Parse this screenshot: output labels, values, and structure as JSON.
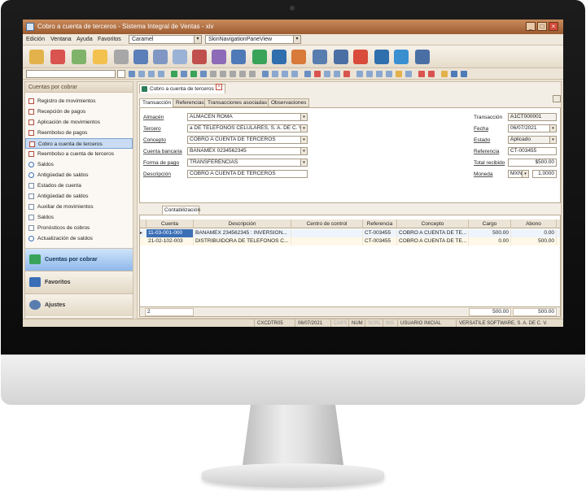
{
  "window": {
    "title": "Cobro a cuenta de terceros - Sistema Integral de Ventas - xiv",
    "minimize": "_",
    "maximize": "□",
    "close": "×"
  },
  "menu": {
    "items": [
      "Edición",
      "Ventana",
      "Ayuda",
      "Favoritos"
    ],
    "skin_combo": "Caramel",
    "nav_combo": "SkinNavigationPaneView"
  },
  "nav": {
    "header": "Cuentas por cobrar",
    "items": [
      {
        "label": "Registro de movimientos",
        "icon": "document-edit-icon"
      },
      {
        "label": "Recepción de pagos",
        "icon": "document-edit-icon"
      },
      {
        "label": "Aplicación de movimientos",
        "icon": "document-edit-icon"
      },
      {
        "label": "Reembolso de pagos",
        "icon": "document-edit-icon"
      },
      {
        "label": "Cobro a cuenta de terceros",
        "icon": "document-edit-icon"
      },
      {
        "label": "Reembolso a cuenta de terceros",
        "icon": "document-edit-icon"
      },
      {
        "label": "Saldos",
        "icon": "search-icon"
      },
      {
        "label": "Antigüedad de saldos",
        "icon": "search-icon"
      },
      {
        "label": "Estados de cuenta",
        "icon": "report-icon"
      },
      {
        "label": "Antigüedad de saldos",
        "icon": "report-icon"
      },
      {
        "label": "Auxiliar de movimientos",
        "icon": "report-icon"
      },
      {
        "label": "Saldos",
        "icon": "report-icon"
      },
      {
        "label": "Pronósticos de cobros",
        "icon": "report-icon"
      },
      {
        "label": "Actualización de saldos",
        "icon": "gear-icon"
      }
    ],
    "groups": [
      {
        "label": "Cuentas por cobrar"
      },
      {
        "label": "Favoritos"
      },
      {
        "label": "Ajustes"
      }
    ]
  },
  "document": {
    "tab_label": "Cobro a cuenta de terceros",
    "subtabs": [
      "Transacción",
      "Referencias",
      "Transacciones asociadas",
      "Observaciones"
    ],
    "fields_left": [
      {
        "label": "Almacén",
        "value": "ALMACEN ROMA"
      },
      {
        "label": "Tercero",
        "value": "a DE TELEFONOS CELULARES, S. A. DE C. V."
      },
      {
        "label": "Concepto",
        "value": "COBRO A CUENTA DE TERCEROS"
      },
      {
        "label": "Cuenta bancaria",
        "value": "BANAMEX 0234562345"
      },
      {
        "label": "Forma de pago",
        "value": "TRANSFERENCIAS"
      },
      {
        "label": "Descripción",
        "value": "COBRO A CUENTA DE TERCEROS"
      }
    ],
    "fields_right": [
      {
        "label": "Transacción",
        "value": "A1CT000001"
      },
      {
        "label": "Fecha",
        "value": "06/07/2021"
      },
      {
        "label": "Estado",
        "value": "Aplicado"
      },
      {
        "label": "Referencia",
        "value": "CT-003455"
      },
      {
        "label": "Total recibido",
        "value": "$500.00"
      },
      {
        "label": "Moneda",
        "value": "MXN",
        "rate": "1.0000"
      }
    ]
  },
  "grid": {
    "tab_label": "Contabilización",
    "columns": [
      "Cuenta",
      "Descripción",
      "Centro de control",
      "Referencia",
      "Concepto",
      "Cargo",
      "Abono"
    ],
    "rows": [
      [
        "11-03-001-000",
        "BANAMEX 234562345 : INVERSION...",
        "",
        "CT-003455",
        "COBRO A CUENTA DE TE...",
        "500.00",
        "0.00"
      ],
      [
        "21-02-102-003",
        "DISTRIBUIDORA DE TELEFONOS C...",
        "",
        "CT-003455",
        "COBRO A CUENTA DE TE...",
        "0.00",
        "500.00"
      ]
    ],
    "row_count": "2",
    "total_cargo": "500.00",
    "total_abono": "500.00"
  },
  "status": {
    "user_code": "CXCDTR05",
    "date": "06/07/2021",
    "caps": "CAPS",
    "num": "NUM",
    "scrl": "SCRL",
    "ins": "INS",
    "user": "USUARIO INICIAL",
    "company": "VERSATILE SOFTWARE, S. A. DE C. V."
  },
  "colors": {
    "titlebar": "#9c5b30",
    "nav_active_group": "#8fb8ea",
    "selected_cell": "#3b6fb6"
  }
}
